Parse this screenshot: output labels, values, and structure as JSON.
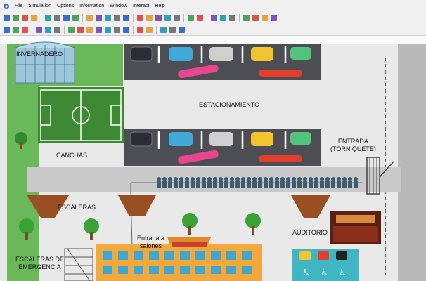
{
  "menu": {
    "items": [
      "File",
      "Simulation",
      "Options",
      "Information",
      "Window",
      "Interact",
      "Help"
    ]
  },
  "toolbar": {
    "row1": [
      "new-doc-icon",
      "open-icon",
      "save-icon",
      "print-icon",
      "sep",
      "play-icon",
      "pause-icon",
      "step-icon",
      "stop-icon",
      "sep",
      "grid-icon",
      "layers-icon",
      "chart-icon",
      "settings-icon",
      "refresh-icon",
      "sep",
      "zoom-icon",
      "pan-icon",
      "select-icon",
      "table-icon",
      "list-icon",
      "sep",
      "plot-icon",
      "export-icon",
      "sep",
      "object-icon",
      "color-icon",
      "shape-icon",
      "sep",
      "help-icon",
      "info-icon",
      "warning-icon",
      "run-icon"
    ],
    "row2": [
      "view-icon",
      "layout-icon",
      "window-icon",
      "sep",
      "arrow-icon",
      "link-icon",
      "search-icon",
      "sep",
      "block1-icon",
      "block2-icon",
      "block3-icon",
      "block4-icon",
      "block5-icon",
      "block6-icon",
      "block7-icon",
      "sep",
      "format-icon",
      "style-icon",
      "sep",
      "align-icon",
      "distribute-icon",
      "tag-icon"
    ]
  },
  "labels": {
    "invernadero": "INVERNADERO",
    "estacionamiento": "ESTACIONAMIENTO",
    "canchas": "CANCHAS",
    "entrada": "ENTRADA\n(TORNIQUETE)",
    "escaleras": "ESCALERAS",
    "entrada_salones": "Entrada a\nsalones",
    "auditorio": "AUDITORIO",
    "escaleras_emergencia": "ESCALERAS DE\nEMERGENCIA"
  },
  "colors": {
    "grass": "#6ab85a",
    "parking": "#4a4c52",
    "road": "#b8b8b8",
    "building": "#f2a83b",
    "queue": "#3d5a73",
    "accessible": "#3fb6c3"
  }
}
